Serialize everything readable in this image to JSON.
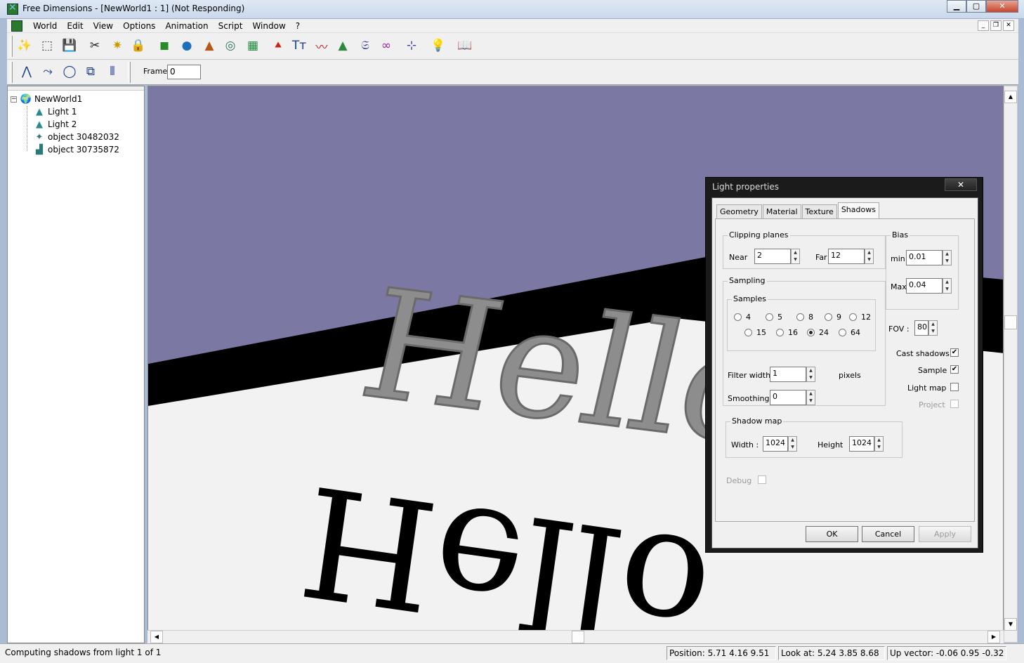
{
  "window": {
    "title": "Free Dimensions - [NewWorld1 : 1] (Not Responding)",
    "minimize": "▁",
    "maximize": "▢",
    "close": "✕"
  },
  "menu": {
    "items": [
      "World",
      "Edit",
      "View",
      "Options",
      "Animation",
      "Script",
      "Window",
      "?"
    ],
    "mdi_min": "_",
    "mdi_restore": "❐",
    "mdi_close": "✕"
  },
  "toolbar": {
    "icons": [
      "wand-icon",
      "cube-icon",
      "save-icon",
      "scissors-icon",
      "sparkle-icon",
      "lock-icon",
      "box-color-icon",
      "sphere-icon",
      "cone-icon",
      "torus-icon",
      "grid-icon",
      "pyramid-icon",
      "text-icon",
      "curve-icon",
      "mountain-icon",
      "helix-icon",
      "loop-icon",
      "axis-icon",
      "bulb-icon",
      "book-icon"
    ],
    "glyphs": [
      "✨",
      "⬚",
      "💾",
      "✂",
      "✷",
      "🔒",
      "◼",
      "●",
      "▲",
      "◎",
      "▦",
      "⯅",
      "Tт",
      "〰",
      "▲",
      "𝔖",
      "∞",
      "⊹",
      "💡",
      "📖"
    ],
    "colors": [
      "#3a6ea5",
      "#333",
      "#1b3b8c",
      "#222",
      "#c99b00",
      "#333",
      "#2a8a2a",
      "#1e6fb8",
      "#b35a1a",
      "#2c7a5a",
      "#1f8c3a",
      "#c21",
      "#1b3b8c",
      "#b41f1f",
      "#2b8a3e",
      "#3a3a9a",
      "#9a1f9a",
      "#3a3aa0",
      "#d8b800",
      "#333"
    ]
  },
  "toolbar2": {
    "icons": [
      "polyline-icon",
      "path-icon",
      "shape-icon",
      "extrude-icon",
      "lathe-icon"
    ],
    "glyphs": [
      "⋀",
      "⤳",
      "◯",
      "⧉",
      "⦀"
    ],
    "frame_label": "Frame:",
    "frame_value": "0"
  },
  "tree": {
    "expander": "−",
    "root": {
      "label": "NewWorld1",
      "icon": "globe-icon",
      "glyph": "🌍"
    },
    "children": [
      {
        "label": "Light 1",
        "icon": "light-icon",
        "glyph": "▲"
      },
      {
        "label": "Light 2",
        "icon": "light-icon",
        "glyph": "▲"
      },
      {
        "label": "object 30482032",
        "icon": "object-icon",
        "glyph": "✦"
      },
      {
        "label": "object 30735872",
        "icon": "object-icon",
        "glyph": "▟"
      }
    ]
  },
  "viewport": {
    "text3d": "Hello",
    "shadow_text": "Hello",
    "sky_color": "#7c78a4",
    "floor_color": "#f2f2f2",
    "shadow_color": "#000000",
    "letter_color": "#8d8d8d"
  },
  "status": {
    "message": "Computing shadows from light 1 of 1",
    "position": "Position: 5.71 4.16 9.51",
    "look_at": "Look at: 5.24 3.85 8.68",
    "up_vector": "Up vector: -0.06 0.95 -0.32"
  },
  "dialog": {
    "title": "Light properties",
    "close": "✕",
    "tabs": [
      "Geometry",
      "Material",
      "Texture",
      "Shadows"
    ],
    "active_tab": "Shadows",
    "clipping": {
      "title": "Clipping planes",
      "near_label": "Near",
      "near_value": "2",
      "far_label": "Far",
      "far_value": "12"
    },
    "bias": {
      "title": "Bias",
      "min_label": "min",
      "min_value": "0.01",
      "max_label": "Max",
      "max_value": "0.04"
    },
    "sampling": {
      "title": "Sampling",
      "samples_title": "Samples",
      "row1": [
        "4",
        "5",
        "8",
        "9",
        "12"
      ],
      "row2": [
        "15",
        "16",
        "24",
        "64"
      ],
      "selected": "24",
      "filter_label": "Filter width",
      "filter_value": "1",
      "filter_unit": "pixels",
      "smoothing_label": "Smoothing",
      "smoothing_value": "0"
    },
    "fov": {
      "label": "FOV :",
      "value": "80"
    },
    "checks": [
      {
        "label": "Cast shadows",
        "checked": true,
        "disabled": false
      },
      {
        "label": "Sample",
        "checked": true,
        "disabled": false
      },
      {
        "label": "Light map",
        "checked": false,
        "disabled": false
      },
      {
        "label": "Project",
        "checked": false,
        "disabled": true
      }
    ],
    "shadow_map": {
      "title": "Shadow map",
      "width_label": "Width :",
      "width_value": "1024",
      "height_label": "Height",
      "height_value": "1024"
    },
    "debug": {
      "label": "Debug",
      "checked": false
    },
    "buttons": {
      "ok": "OK",
      "cancel": "Cancel",
      "apply": "Apply"
    }
  }
}
